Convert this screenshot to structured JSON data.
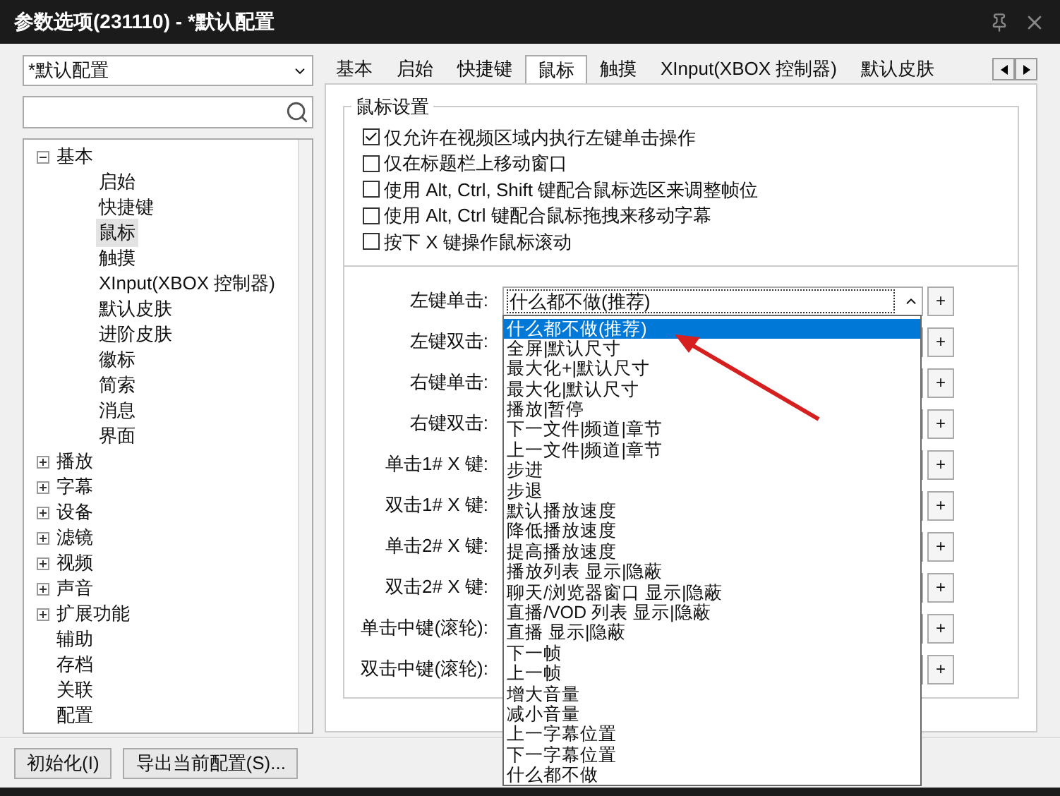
{
  "window": {
    "title": "参数选项(231110) - *默认配置"
  },
  "profile": {
    "value": "*默认配置"
  },
  "tree": [
    {
      "label": "基本",
      "expanded": true,
      "selected": false,
      "children": [
        {
          "label": "启始",
          "selected": false
        },
        {
          "label": "快捷键",
          "selected": false
        },
        {
          "label": "鼠标",
          "selected": true
        },
        {
          "label": "触摸",
          "selected": false
        },
        {
          "label": "XInput(XBOX 控制器)",
          "selected": false
        },
        {
          "label": "默认皮肤",
          "selected": false
        },
        {
          "label": "进阶皮肤",
          "selected": false
        },
        {
          "label": "徽标",
          "selected": false
        },
        {
          "label": "简索",
          "selected": false
        },
        {
          "label": "消息",
          "selected": false
        },
        {
          "label": "界面",
          "selected": false
        }
      ]
    },
    {
      "label": "播放",
      "expanded": false,
      "selected": false
    },
    {
      "label": "字幕",
      "expanded": false,
      "selected": false
    },
    {
      "label": "设备",
      "expanded": false,
      "selected": false
    },
    {
      "label": "滤镜",
      "expanded": false,
      "selected": false
    },
    {
      "label": "视频",
      "expanded": false,
      "selected": false
    },
    {
      "label": "声音",
      "expanded": false,
      "selected": false
    },
    {
      "label": "扩展功能",
      "expanded": false,
      "selected": false
    },
    {
      "label": "辅助",
      "selected": false
    },
    {
      "label": "存档",
      "selected": false
    },
    {
      "label": "关联",
      "selected": false
    },
    {
      "label": "配置",
      "selected": false
    }
  ],
  "tabs": [
    {
      "label": "基本",
      "selected": false
    },
    {
      "label": "启始",
      "selected": false
    },
    {
      "label": "快捷键",
      "selected": false
    },
    {
      "label": "鼠标",
      "selected": true
    },
    {
      "label": "触摸",
      "selected": false
    },
    {
      "label": "XInput(XBOX 控制器)",
      "selected": false
    },
    {
      "label": "默认皮肤",
      "selected": false
    }
  ],
  "group": {
    "title": "鼠标设置"
  },
  "options": [
    {
      "label": "仅允许在视频区域内执行左键单击操作",
      "checked": true
    },
    {
      "label": "仅在标题栏上移动窗口",
      "checked": false
    },
    {
      "label": "使用 Alt, Ctrl, Shift 键配合鼠标选区来调整帧位",
      "checked": false
    },
    {
      "label": "使用 Alt, Ctrl 键配合鼠标拖拽来移动字幕",
      "checked": false
    },
    {
      "label": "按下 X 键操作鼠标滚动",
      "checked": false
    }
  ],
  "actions": [
    {
      "label": "左键单击:",
      "value": "什么都不做(推荐)",
      "add": "+"
    },
    {
      "label": "左键双击:",
      "add": "+"
    },
    {
      "label": "右键单击:",
      "add": "+"
    },
    {
      "label": "右键双击:",
      "add": "+"
    },
    {
      "label": "单击1# X 键:",
      "add": "+"
    },
    {
      "label": "双击1# X 键:",
      "add": "+"
    },
    {
      "label": "单击2# X 键:",
      "add": "+"
    },
    {
      "label": "双击2# X 键:",
      "add": "+"
    },
    {
      "label": "单击中键(滚轮):",
      "add": "+"
    },
    {
      "label": "双击中键(滚轮):",
      "add": "+"
    }
  ],
  "dropdown": [
    {
      "label": "什么都不做(推荐)",
      "selected": true
    },
    {
      "label": "全屏|默认尺寸",
      "selected": false
    },
    {
      "label": "最大化+|默认尺寸",
      "selected": false
    },
    {
      "label": "最大化|默认尺寸",
      "selected": false
    },
    {
      "label": "播放|暂停",
      "selected": false
    },
    {
      "label": "下一文件|频道|章节",
      "selected": false
    },
    {
      "label": "上一文件|频道|章节",
      "selected": false
    },
    {
      "label": "步进",
      "selected": false
    },
    {
      "label": "步退",
      "selected": false
    },
    {
      "label": "默认播放速度",
      "selected": false
    },
    {
      "label": "降低播放速度",
      "selected": false
    },
    {
      "label": "提高播放速度",
      "selected": false
    },
    {
      "label": "播放列表 显示|隐蔽",
      "selected": false
    },
    {
      "label": "聊天/浏览器窗口 显示|隐蔽",
      "selected": false
    },
    {
      "label": "直播/VOD 列表 显示|隐蔽",
      "selected": false
    },
    {
      "label": "直播 显示|隐蔽",
      "selected": false
    },
    {
      "label": "下一帧",
      "selected": false
    },
    {
      "label": "上一帧",
      "selected": false
    },
    {
      "label": "增大音量",
      "selected": false
    },
    {
      "label": "减小音量",
      "selected": false
    },
    {
      "label": "上一字幕位置",
      "selected": false
    },
    {
      "label": "下一字幕位置",
      "selected": false
    },
    {
      "label": "什么都不做",
      "selected": false
    }
  ],
  "buttons": [
    {
      "label": "初始化(I)"
    },
    {
      "label": "导出当前配置(S)..."
    }
  ]
}
